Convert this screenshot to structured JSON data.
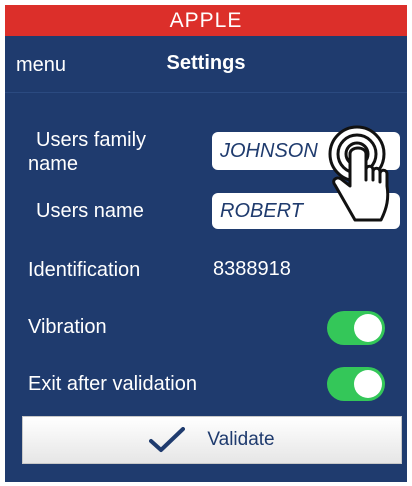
{
  "banner": {
    "title": "APPLE"
  },
  "navbar": {
    "menu_label": "menu",
    "title": "Settings"
  },
  "form": {
    "family_name_label_line1": "Users family",
    "family_name_label_line2": "name",
    "family_name_value": "JOHNSON",
    "name_label": "Users name",
    "name_value": "ROBERT",
    "identification_label": "Identification",
    "identification_value": "8388918",
    "vibration_label": "Vibration",
    "vibration_on": true,
    "exit_label": "Exit after validation",
    "exit_on": true
  },
  "actions": {
    "validate_label": "Validate"
  },
  "icons": {
    "check": "checkmark-icon",
    "tap": "tap-hand-icon"
  },
  "colors": {
    "banner": "#dc2f2a",
    "panel": "#1f3b6e",
    "toggle_on": "#34c759"
  }
}
